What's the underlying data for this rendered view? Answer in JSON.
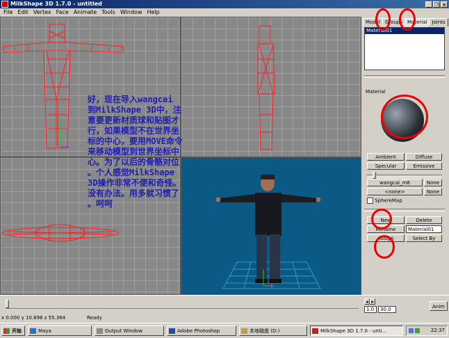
{
  "window": {
    "title": "MilkShape 3D 1.7.0 - untitled",
    "min_glyph": "_",
    "restore_glyph": "❐",
    "close_glyph": "×"
  },
  "menu": [
    "File",
    "Edit",
    "Vertex",
    "Face",
    "Animate",
    "Tools",
    "Window",
    "Help"
  ],
  "overlay_text": [
    "好，现在导入wangcai",
    "到MilkShape 3D中，注",
    "意要更新材质球和贴图才",
    "行，如果模型不在世界坐",
    "标的中心，要用MOVE命令",
    "来移动模型到世界坐标中",
    "心。为了以后的骨骼对位",
    "。个人感觉MilkShape",
    "3D操作非常不便和奇怪。",
    "没有办法。用多就习惯了",
    "。呵呵"
  ],
  "panel": {
    "tabs": [
      "Model",
      "Groups",
      "Material",
      "Joints"
    ],
    "materials": [
      "Material01"
    ],
    "material_label": "Material",
    "ambient": "Ambient",
    "diffuse": "Diffuse",
    "specular": "Specular",
    "emissive": "Emissive",
    "texture1": "wangcai_m8",
    "texture2": "<none>",
    "none": "None",
    "spheremap": "SphereMap",
    "new": "New",
    "delete": "Delete",
    "rename": "Rename",
    "name_value": "Material01",
    "assign": "Assign",
    "select_by": "Select By"
  },
  "timeline": {
    "frame": "1.0",
    "total": "30.0",
    "anim": "Anim"
  },
  "status": {
    "coords": "x 0.000 y 10.898 z 55.364",
    "state": "Ready"
  },
  "taskbar": {
    "start": "开始",
    "tasks": [
      "Maya",
      "Output Window",
      "Adobe Photoshop",
      "本地磁盘 (D:)",
      "MilkShape 3D 1.7.0 - unti..."
    ],
    "clock": "22:37"
  },
  "colors": {
    "wire": "#ff2020",
    "viewport": "#888888",
    "viewport3d": "#0b5a86",
    "overlay": "#1e1eb4",
    "annotation": "#ee0000"
  }
}
